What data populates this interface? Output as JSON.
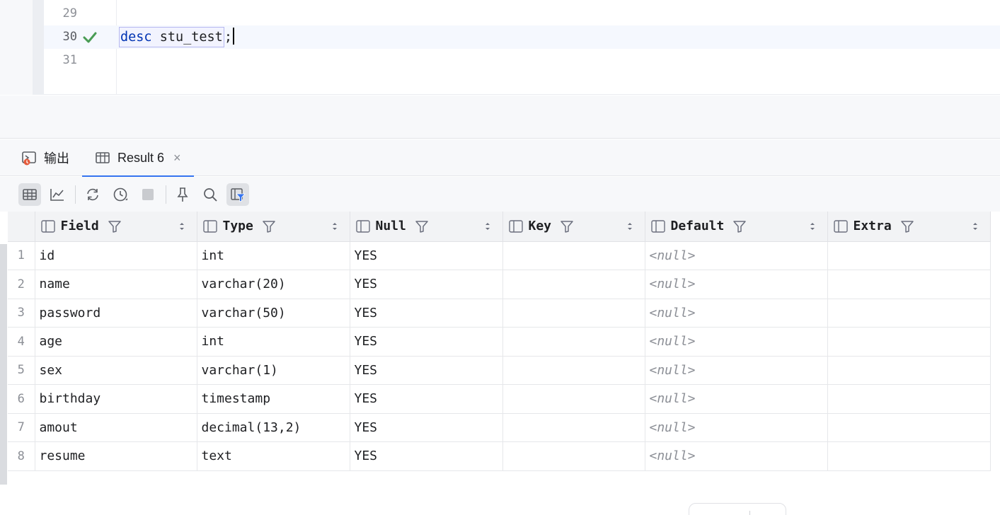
{
  "editor": {
    "lines": [
      {
        "number": "29",
        "code_keyword": "",
        "code_rest": "",
        "has_check": false
      },
      {
        "number": "30",
        "code_keyword": "desc",
        "code_rest": " stu_test",
        "code_end": ";",
        "has_check": true
      },
      {
        "number": "31",
        "code_keyword": "",
        "code_rest": "",
        "has_check": false
      }
    ],
    "check_icon": "checkmark-icon",
    "check_color": "#499c54"
  },
  "tabs": [
    {
      "label": "输出",
      "icon": "output-console-icon",
      "active": false
    },
    {
      "label": "Result 6",
      "icon": "table-icon",
      "active": true,
      "close": "×"
    }
  ],
  "toolbar": {
    "buttons": [
      "table-view-icon",
      "chart-view-icon",
      "refresh-icon",
      "history-icon",
      "stop-icon",
      "pin-icon",
      "search-icon",
      "filter-grid-icon"
    ]
  },
  "grid": {
    "columns": [
      "Field",
      "Type",
      "Null",
      "Key",
      "Default",
      "Extra"
    ],
    "rows": [
      {
        "n": "1",
        "field": "id",
        "type": "int",
        "null": "YES",
        "key": "",
        "default": "<null>",
        "extra": ""
      },
      {
        "n": "2",
        "field": "name",
        "type": "varchar(20)",
        "null": "YES",
        "key": "",
        "default": "<null>",
        "extra": ""
      },
      {
        "n": "3",
        "field": "password",
        "type": "varchar(50)",
        "null": "YES",
        "key": "",
        "default": "<null>",
        "extra": ""
      },
      {
        "n": "4",
        "field": "age",
        "type": "int",
        "null": "YES",
        "key": "",
        "default": "<null>",
        "extra": ""
      },
      {
        "n": "5",
        "field": "sex",
        "type": "varchar(1)",
        "null": "YES",
        "key": "",
        "default": "<null>",
        "extra": ""
      },
      {
        "n": "6",
        "field": "birthday",
        "type": "timestamp",
        "null": "YES",
        "key": "",
        "default": "<null>",
        "extra": ""
      },
      {
        "n": "7",
        "field": "amout",
        "type": "decimal(13,2)",
        "null": "YES",
        "key": "",
        "default": "<null>",
        "extra": ""
      },
      {
        "n": "8",
        "field": "resume",
        "type": "text",
        "null": "YES",
        "key": "",
        "default": "<null>",
        "extra": ""
      }
    ]
  },
  "colors": {
    "accent": "#3574f0",
    "keyword": "#0033b3",
    "muted": "#8c8f96"
  }
}
